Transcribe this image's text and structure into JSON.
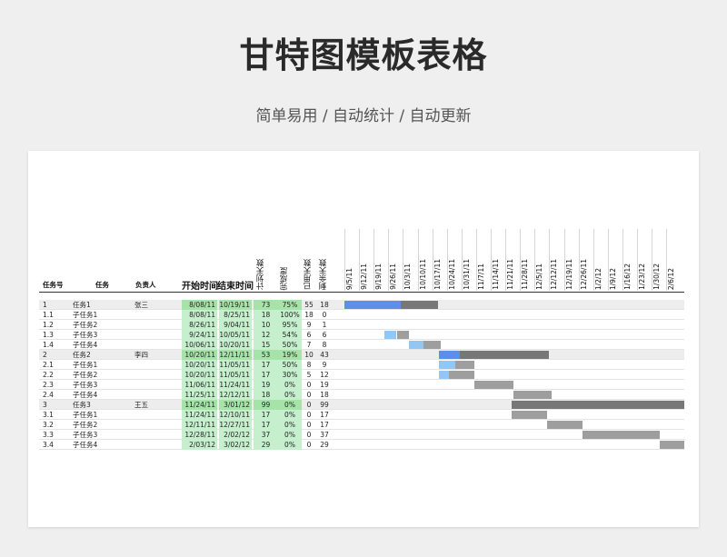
{
  "header": {
    "title": "甘特图模板表格",
    "subtitle": "简单易用  /  自动统计  /  自动更新"
  },
  "table": {
    "headers": {
      "id": "任务号",
      "task": "任务",
      "owner": "负责人",
      "start": "开始时间",
      "end": "结束时间",
      "planned": "计划天数",
      "done": "完成度",
      "used": "已用天数",
      "remain": "剩余天数"
    },
    "rows": [
      {
        "id": "1",
        "task": "任务1",
        "owner": "张三",
        "start": "8/08/11",
        "end": "10/19/11",
        "planned": "73",
        "done": "75%",
        "used": "55",
        "remain": "18",
        "parent": true
      },
      {
        "id": "1.1",
        "task": "子任务1",
        "owner": "",
        "start": "8/08/11",
        "end": "8/25/11",
        "planned": "18",
        "done": "100%",
        "used": "18",
        "remain": "0"
      },
      {
        "id": "1.2",
        "task": "子任务2",
        "owner": "",
        "start": "8/26/11",
        "end": "9/04/11",
        "planned": "10",
        "done": "95%",
        "used": "9",
        "remain": "1"
      },
      {
        "id": "1.3",
        "task": "子任务3",
        "owner": "",
        "start": "9/24/11",
        "end": "10/05/11",
        "planned": "12",
        "done": "54%",
        "used": "6",
        "remain": "6"
      },
      {
        "id": "1.4",
        "task": "子任务4",
        "owner": "",
        "start": "10/06/11",
        "end": "10/20/11",
        "planned": "15",
        "done": "50%",
        "used": "7",
        "remain": "8"
      },
      {
        "id": "2",
        "task": "任务2",
        "owner": "李四",
        "start": "10/20/11",
        "end": "12/11/11",
        "planned": "53",
        "done": "19%",
        "used": "10",
        "remain": "43",
        "parent": true
      },
      {
        "id": "2.1",
        "task": "子任务1",
        "owner": "",
        "start": "10/20/11",
        "end": "11/05/11",
        "planned": "17",
        "done": "50%",
        "used": "8",
        "remain": "9"
      },
      {
        "id": "2.2",
        "task": "子任务2",
        "owner": "",
        "start": "10/20/11",
        "end": "11/05/11",
        "planned": "17",
        "done": "30%",
        "used": "5",
        "remain": "12"
      },
      {
        "id": "2.3",
        "task": "子任务3",
        "owner": "",
        "start": "11/06/11",
        "end": "11/24/11",
        "planned": "19",
        "done": "0%",
        "used": "0",
        "remain": "19"
      },
      {
        "id": "2.4",
        "task": "子任务4",
        "owner": "",
        "start": "11/25/11",
        "end": "12/12/11",
        "planned": "18",
        "done": "0%",
        "used": "0",
        "remain": "18"
      },
      {
        "id": "3",
        "task": "任务3",
        "owner": "王五",
        "start": "11/24/11",
        "end": "3/01/12",
        "planned": "99",
        "done": "0%",
        "used": "0",
        "remain": "99",
        "parent": true
      },
      {
        "id": "3.1",
        "task": "子任务1",
        "owner": "",
        "start": "11/24/11",
        "end": "12/10/11",
        "planned": "17",
        "done": "0%",
        "used": "0",
        "remain": "17"
      },
      {
        "id": "3.2",
        "task": "子任务2",
        "owner": "",
        "start": "12/11/11",
        "end": "12/27/11",
        "planned": "17",
        "done": "0%",
        "used": "0",
        "remain": "17"
      },
      {
        "id": "3.3",
        "task": "子任务3",
        "owner": "",
        "start": "12/28/11",
        "end": "2/02/12",
        "planned": "37",
        "done": "0%",
        "used": "0",
        "remain": "37"
      },
      {
        "id": "3.4",
        "task": "子任务4",
        "owner": "",
        "start": "2/03/12",
        "end": "3/02/12",
        "planned": "29",
        "done": "0%",
        "used": "0",
        "remain": "29"
      }
    ]
  },
  "gantt": {
    "week_labels": [
      "9/5/11",
      "9/12/11",
      "9/19/11",
      "9/26/11",
      "10/3/11",
      "10/10/11",
      "10/17/11",
      "10/24/11",
      "10/31/11",
      "11/7/11",
      "11/14/11",
      "11/21/11",
      "11/28/11",
      "12/5/11",
      "12/12/11",
      "12/19/11",
      "12/26/11",
      "1/2/12",
      "1/9/12",
      "1/16/12",
      "1/23/12",
      "1/30/12",
      "2/6/12"
    ],
    "colors": {
      "done_parent": "#5b8fe8",
      "done_child": "#92c7f5",
      "remaining_parent": "#777777",
      "remaining_child": "#9e9e9e"
    }
  }
}
